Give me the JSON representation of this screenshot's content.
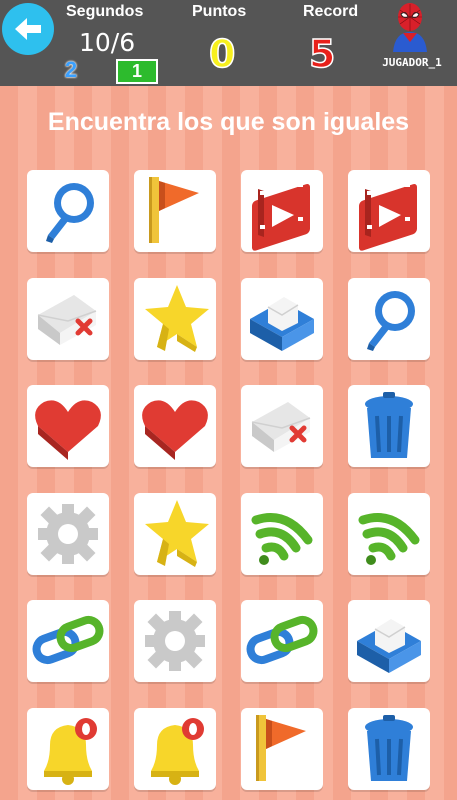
{
  "header": {
    "seconds_label": "Segundos",
    "points_label": "Puntos",
    "record_label": "Record",
    "timer": "10/6",
    "found_count": "2",
    "errors_count": "1",
    "points": "0",
    "record": "5",
    "player_name": "JUGADOR_1",
    "colors": {
      "bar": "#555555",
      "back_button": "#2ec0ee",
      "points": "#f7f01e",
      "record": "#e8201a",
      "found": "#3aa0ff",
      "errors_badge": "#2dbb2d"
    }
  },
  "instruction": "Encuentra los que son iguales",
  "board": {
    "rows": [
      [
        "magnifier-icon",
        "flag-icon",
        "video-icon",
        "video-icon"
      ],
      [
        "mail-delete-icon",
        "star-icon",
        "inbox-icon",
        "magnifier-icon"
      ],
      [
        "heart-icon",
        "heart-icon",
        "mail-delete-icon",
        "trash-icon"
      ],
      [
        "gear-icon",
        "star-icon",
        "wifi-icon",
        "wifi-icon"
      ],
      [
        "link-icon",
        "gear-icon",
        "link-icon",
        "inbox-icon"
      ],
      [
        "bell-icon",
        "bell-icon",
        "flag-icon",
        "trash-icon"
      ]
    ]
  }
}
